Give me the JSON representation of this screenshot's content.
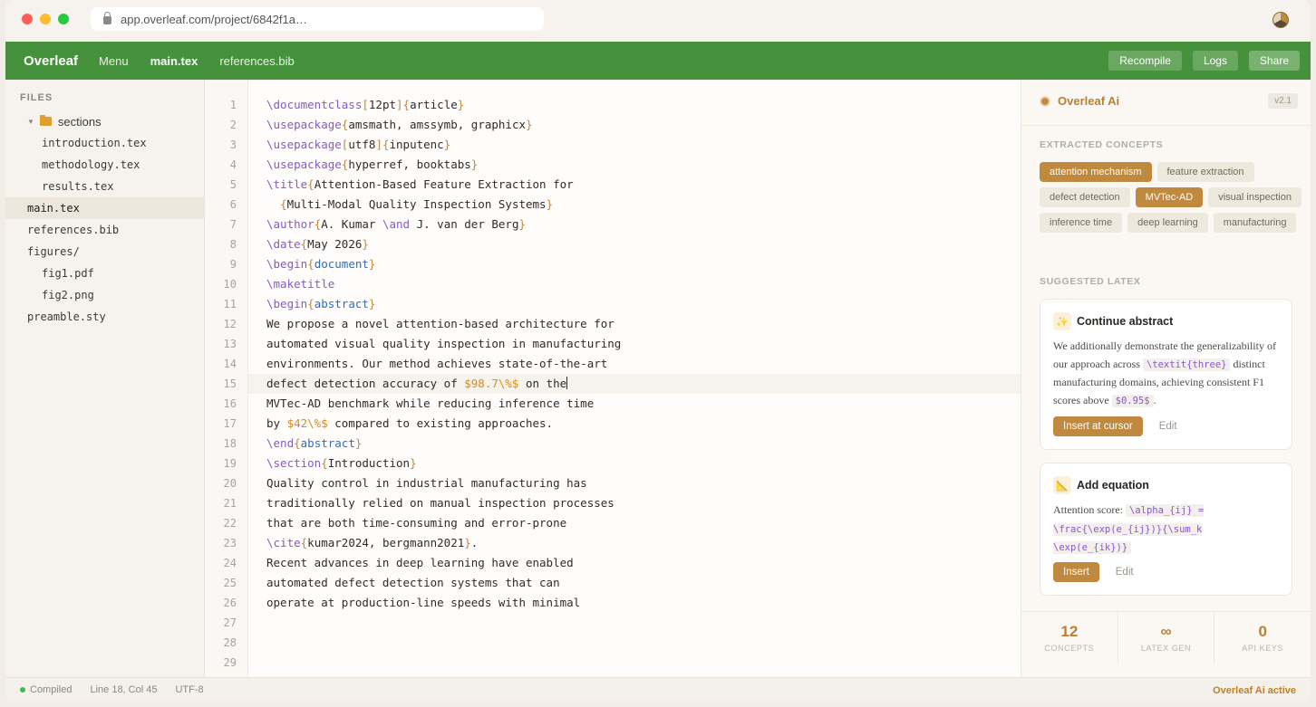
{
  "browser": {
    "url": "app.overleaf.com/project/6842f1a…"
  },
  "nav": {
    "brand": "Overleaf",
    "menu": "Menu",
    "tabs": [
      "main.tex",
      "references.bib"
    ],
    "buttons": {
      "recompile": "Recompile",
      "logs": "Logs",
      "share": "Share"
    }
  },
  "files": {
    "title": "FILES",
    "items": [
      {
        "label": "sections",
        "type": "folder"
      },
      {
        "label": "introduction.tex"
      },
      {
        "label": "methodology.tex"
      },
      {
        "label": "results.tex"
      },
      {
        "label": "main.tex",
        "selected": true
      },
      {
        "label": "references.bib"
      },
      {
        "label": "figures/"
      },
      {
        "label": "fig1.pdf"
      },
      {
        "label": "fig2.png"
      },
      {
        "label": "preamble.sty"
      }
    ]
  },
  "editor": {
    "line_count": 29,
    "current_line": 15,
    "lines": [
      "\\documentclass[12pt]{article}",
      "\\usepackage{amsmath, amssymb, graphicx}",
      "\\usepackage[utf8]{inputenc}",
      "\\usepackage{hyperref, booktabs}",
      "\\title{Attention-Based Feature Extraction for",
      "  {Multi-Modal Quality Inspection Systems}",
      "\\author{A. Kumar \\and J. van der Berg}",
      "\\date{May 2026}",
      "\\begin{document}",
      "\\maketitle",
      "\\begin{abstract}",
      "We propose a novel attention-based architecture for",
      "automated visual quality inspection in manufacturing",
      "environments. Our method achieves state-of-the-art",
      "defect detection accuracy of $98.7\\%$ on the",
      "MVTec-AD benchmark while reducing inference time",
      "by $42\\%$ compared to existing approaches.",
      "\\end{abstract}",
      "\\section{Introduction}",
      "Quality control in industrial manufacturing has",
      "traditionally relied on manual inspection processes",
      "that are both time-consuming and error-prone",
      "\\cite{kumar2024, bergmann2021}.",
      "Recent advances in deep learning have enabled",
      "automated defect detection systems that can",
      "operate at production-line speeds with minimal",
      "",
      "",
      ""
    ]
  },
  "ai": {
    "title": "Overleaf Ai",
    "version": "v2.1",
    "concepts_label": "EXTRACTED CONCEPTS",
    "concepts": [
      {
        "label": "attention mechanism",
        "active": true
      },
      {
        "label": "feature extraction",
        "active": false
      },
      {
        "label": "defect detection",
        "active": false
      },
      {
        "label": "MVTec-AD",
        "active": true
      },
      {
        "label": "visual inspection",
        "active": false
      },
      {
        "label": "inference time",
        "active": false
      },
      {
        "label": "deep learning",
        "active": false
      },
      {
        "label": "manufacturing",
        "active": false
      }
    ],
    "suggested_label": "SUGGESTED LATEX",
    "suggestions": [
      {
        "title": "Continue abstract",
        "icon": "sparkles-icon",
        "text_parts": [
          "We additionally demonstrate the generalizability of our approach across ",
          "\\textit{three}",
          " distinct manufacturing domains, achieving consistent F1 scores above ",
          "$0.95$",
          "."
        ],
        "primary": "Insert at cursor",
        "edit": "Edit"
      },
      {
        "title": "Add equation",
        "icon": "triangle-ruler-icon",
        "text_parts": [
          "Attention score: ",
          "\\alpha_{ij} = \\frac{\\exp(e_{ij})}{\\sum_k \\exp(e_{ik})}"
        ],
        "primary": "Insert",
        "edit": "Edit"
      }
    ],
    "stats": [
      {
        "value": "12",
        "label": "CONCEPTS"
      },
      {
        "value": "∞",
        "label": "LATEX GEN"
      },
      {
        "value": "0",
        "label": "API KEYS"
      }
    ]
  },
  "status": {
    "compiled": "Compiled",
    "position": "Line 18, Col 45",
    "encoding": "UTF-8",
    "right": "Overleaf Ai active"
  }
}
